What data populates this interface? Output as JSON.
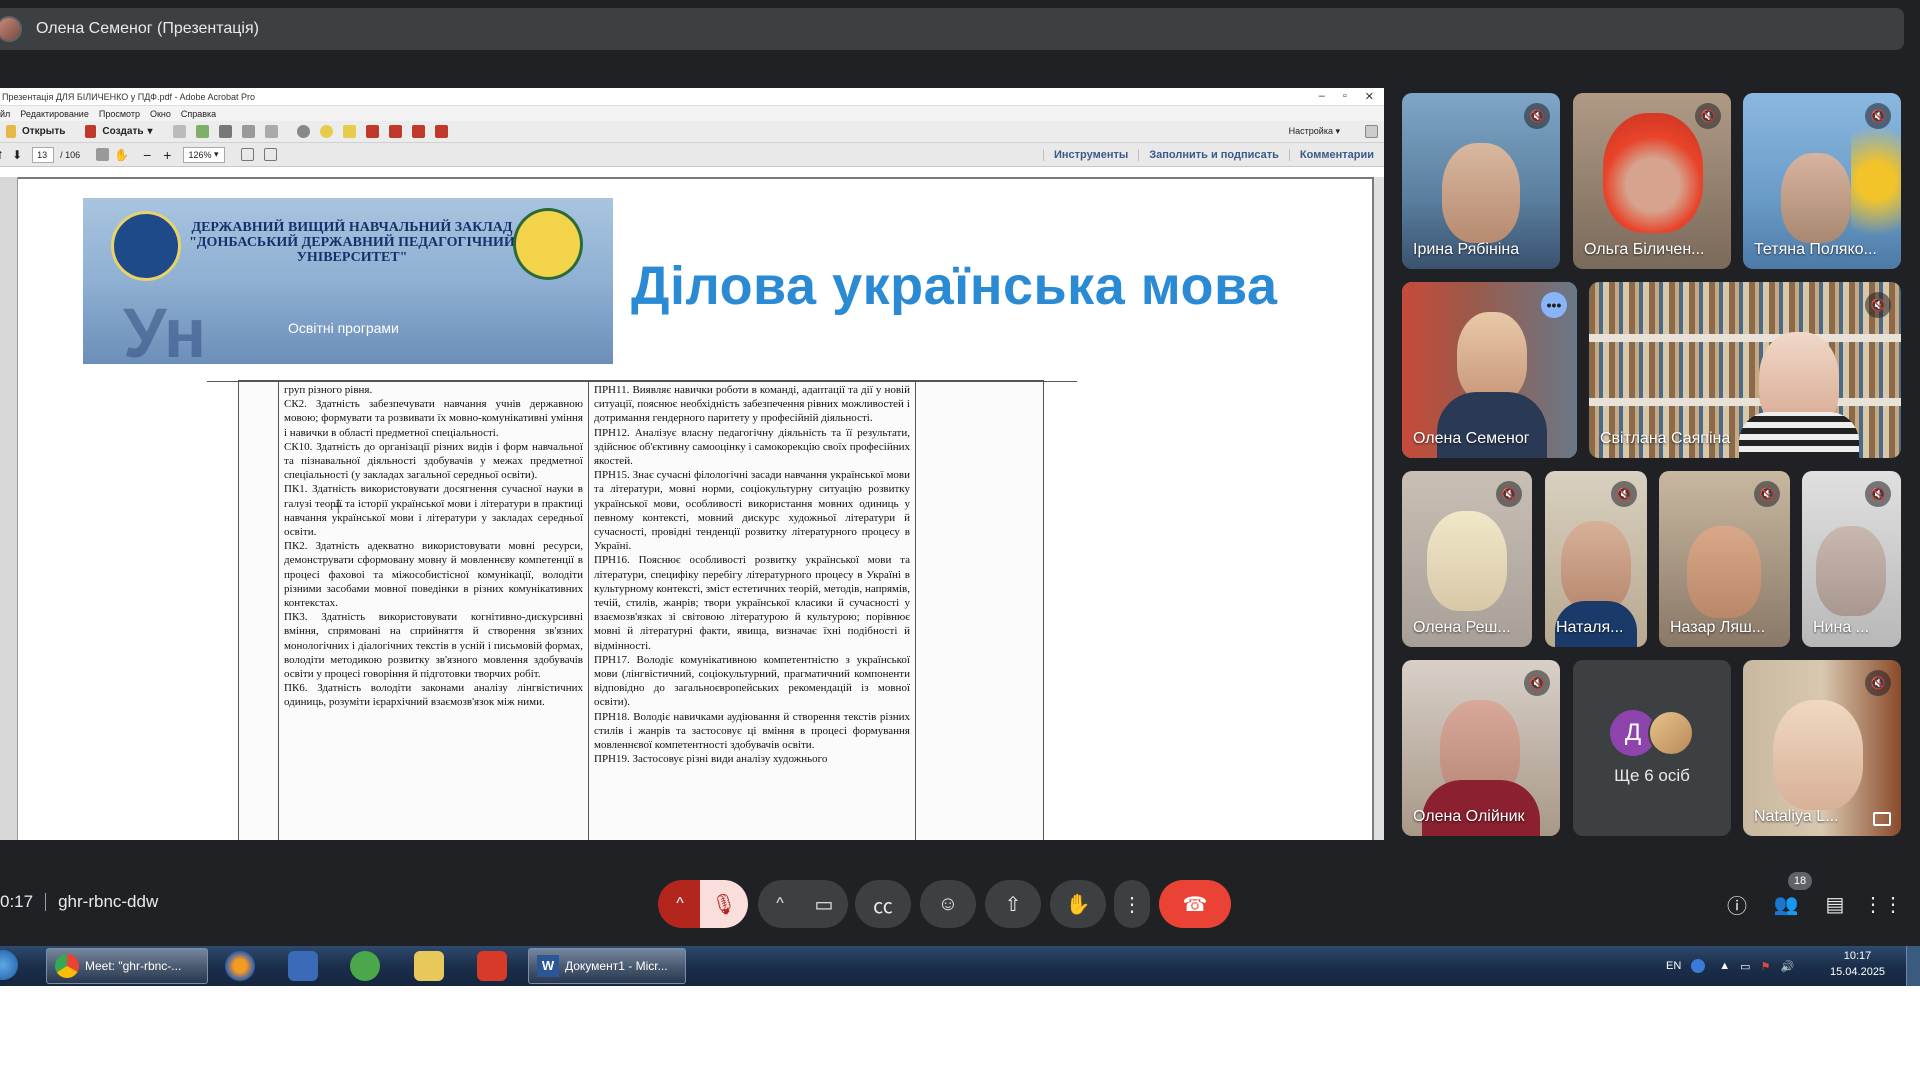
{
  "meet": {
    "presenter_title": "Олена Семеног (Презентація)",
    "time": "0:17",
    "meeting_code": "ghr-rbnc-ddw",
    "participants_count": "18",
    "more_label": "Ще 6 осіб",
    "more_initial": "Д",
    "tiles": [
      {
        "name": "Ірина Рябініна",
        "muted": true
      },
      {
        "name": "Ольга Біличен...",
        "muted": true
      },
      {
        "name": "Тетяна Поляко...",
        "muted": true
      },
      {
        "name": "Олена Семеног",
        "muted": false,
        "active": true
      },
      {
        "name": "Світлана Саяпіна",
        "muted": true
      },
      {
        "name": "Олена Реш...",
        "muted": true
      },
      {
        "name": "Наталя...",
        "muted": true
      },
      {
        "name": "Назар Ляш...",
        "muted": true
      },
      {
        "name": "Нина ...",
        "muted": true
      },
      {
        "name": "Олена Олійник",
        "muted": true
      },
      {
        "name": "Nataliya L...",
        "muted": true
      }
    ]
  },
  "acrobat": {
    "window_title": "Презентація ДЛЯ БІЛИЧЕНКО у ПДФ.pdf - Adobe Acrobat Pro",
    "menu": [
      "йл",
      "Редактирование",
      "Просмотр",
      "Окно",
      "Справка"
    ],
    "open_label": "Открыть",
    "create_label": "Создать",
    "settings_label": "Настройка",
    "page_current": "13",
    "page_total": "/ 106",
    "zoom": "126%",
    "tools_link": "Инструменты",
    "fill_sign_link": "Заполнить и подписать",
    "comments_link": "Комментарии"
  },
  "slide": {
    "banner_line1": "ДЕРЖАВНИЙ ВИЩИЙ НАВЧАЛЬНИЙ ЗАКЛАД",
    "banner_line2": "\"ДОНБАСЬКИЙ ДЕРЖАВНИЙ ПЕДАГОГІЧНИЙ",
    "banner_line3": "УНІВЕРСИТЕТ\"",
    "banner_sub": "Освітні програми",
    "title": "Ділова українська мова",
    "col1": "груп різного рівня.\nСК2. Здатність забезпечувати навчання учнів державною мовою; формувати та розвивати їх мовно-комунікативні уміння і навички в області предметної спеціальності.\nСК10. Здатність до організації різних видів і форм навчальної та пізнавальної діяльності здобувачів у межах предметної спеціальності (у закладах загальної середньої освіти).\nПК1. Здатність використовувати досягнення сучасної науки в галузі теорії та історії української мови і літератури в практиці навчання української мови і літератури у закладах середньої освіти.\nПК2. Здатність адекватно використовувати мовні ресурси, демонструвати сформовану мовну й мовленнєву компетенції в процесі фаховоі та міжособистісної комунікації, володіти різними засобами мовної поведінки в різних комунікативних контекстах.\nПК3. Здатність використовувати когнітивно-дискурсивні вміння, спрямовані на сприйняття й створення зв'язних монологічних і діалогічних текстів в усній і письмовій формах, володіти методикою розвитку зв'язного мовлення здобувачів освіти у процесі говоріння й підготовки творчих робіт.\nПК6. Здатність володіти законами аналізу лінгвістичних одиниць, розуміти ієрархічний взаємозв'язок між ними.",
    "col2": "ПРН11. Виявляє навички роботи в команді, адаптації та дії у новій ситуації, пояснює необхідність забезпечення рівних можливостей і дотримання гендерного паритету у професійній діяльності.\nПРН12. Аналізує власну педагогічну діяльність та її результати, здійснює об'єктивну самооцінку і самокорекцію своїх професійних якостей.\nПРН15. Знає сучасні філологічні засади навчання української мови та літератури, мовні норми, соціокультурну ситуацію розвитку української мови, особливості використання мовних одиниць у певному контексті, мовний дискурс художньої літератури й сучасності, провідні тенденції розвитку літературного процесу в Україні.\nПРН16. Пояснює особливості розвитку української мови та літератури, специфіку перебігу літературного процесу в Україні в культурному контексті, зміст естетичних теорій, методів, напрямів, течій, стилів, жанрів; твори української класики й сучасності у взаємозв'язках зі світовою літературою й культурою; порівнює мовні й літературні факти, явища, визначає їхні подібності й відмінності.\nПРН17. Володіє комунікативною компетентністю з української мови (лінгвістичний, соціокультурний, прагматичний компоненти відповідно до загальноєвропейських рекомендацій із мовної освіти).\nПРН18. Володіє навичками аудіювання й створення текстів різних стилів і жанрів та застосовує ці вміння в процесі формування мовленнєвої компетентності здобувачів освіти.\nПРН19. Застосовує різні види аналізу художнього"
  },
  "taskbar": {
    "chrome_task": "Meet: \"ghr-rbnc-...",
    "word_task": "Документ1 - Micr...",
    "lang": "EN",
    "time": "10:17",
    "date": "15.04.2025"
  },
  "colors": {
    "meet_bg": "#202124",
    "tile_bg": "#3c4043",
    "end_call": "#ea4335",
    "title_blue": "#2a8ad4",
    "active_outline": "#8ab4f8"
  }
}
